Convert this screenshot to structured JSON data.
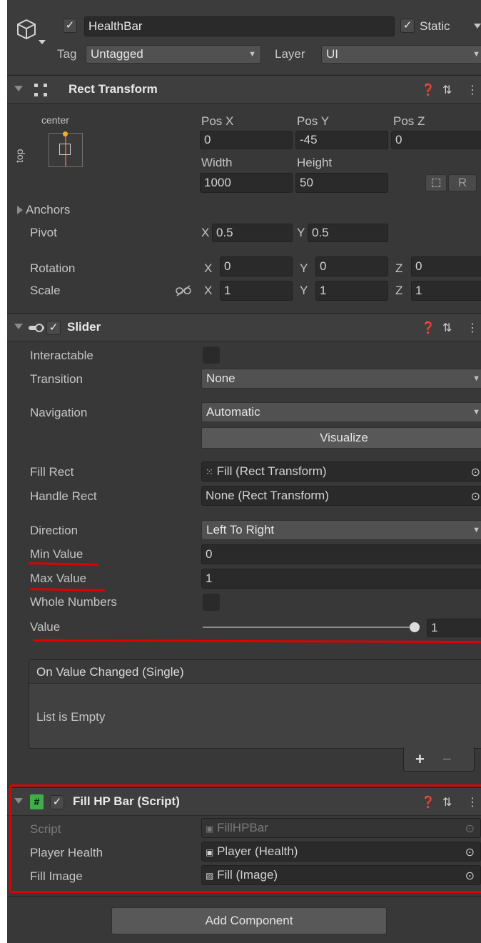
{
  "object": {
    "name": "HealthBar",
    "active": true,
    "static_label": "Static",
    "static_checked": true,
    "tag_label": "Tag",
    "tag_value": "Untagged",
    "layer_label": "Layer",
    "layer_value": "UI"
  },
  "rect_transform": {
    "title": "Rect Transform",
    "anchor_h": "center",
    "anchor_v": "top",
    "pos_x_label": "Pos X",
    "pos_y_label": "Pos Y",
    "pos_z_label": "Pos Z",
    "pos_x": "0",
    "pos_y": "-45",
    "pos_z": "0",
    "width_label": "Width",
    "height_label": "Height",
    "width": "1000",
    "height": "50",
    "raw_button": "R",
    "anchors_label": "Anchors",
    "pivot_label": "Pivot",
    "pivot_x": "0.5",
    "pivot_y": "0.5",
    "rotation_label": "Rotation",
    "rotation_x": "0",
    "rotation_y": "0",
    "rotation_z": "0",
    "scale_label": "Scale",
    "scale_x": "1",
    "scale_y": "1",
    "scale_z": "1",
    "x": "X",
    "y": "Y",
    "z": "Z"
  },
  "slider": {
    "title": "Slider",
    "enabled": true,
    "interactable_label": "Interactable",
    "interactable": false,
    "transition_label": "Transition",
    "transition_value": "None",
    "navigation_label": "Navigation",
    "navigation_value": "Automatic",
    "visualize_label": "Visualize",
    "fill_rect_label": "Fill Rect",
    "fill_rect_value": "Fill (Rect Transform)",
    "handle_rect_label": "Handle Rect",
    "handle_rect_value": "None (Rect Transform)",
    "direction_label": "Direction",
    "direction_value": "Left To Right",
    "min_value_label": "Min Value",
    "min_value": "0",
    "max_value_label": "Max Value",
    "max_value": "1",
    "whole_numbers_label": "Whole Numbers",
    "whole_numbers": false,
    "value_label": "Value",
    "value": "1",
    "value_fraction": 1.0,
    "event_title": "On Value Changed (Single)",
    "event_empty": "List is Empty",
    "add_label": "+",
    "remove_label": "−"
  },
  "script_component": {
    "title": "Fill HP Bar (Script)",
    "enabled": true,
    "script_label": "Script",
    "script_value": "FillHPBar",
    "player_health_label": "Player Health",
    "player_health_value": "Player (Health)",
    "fill_image_label": "Fill Image",
    "fill_image_value": "Fill (Image)"
  },
  "add_component_label": "Add Component",
  "colors": {
    "panel_bg": "#383838",
    "field_bg": "#2a2a2a",
    "annotation_red": "#e00000",
    "script_icon_green": "#3fae49"
  }
}
